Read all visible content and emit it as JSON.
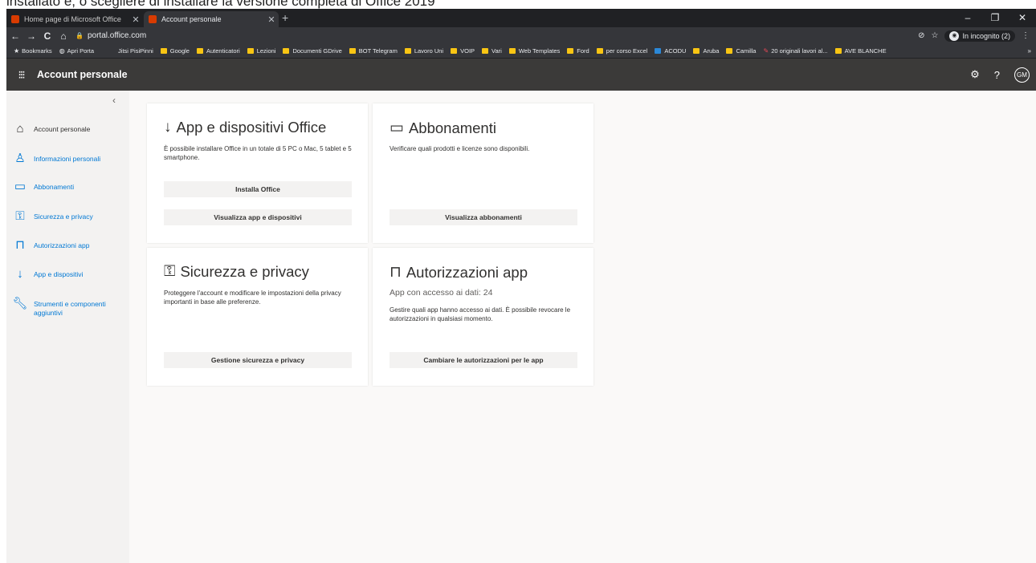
{
  "doc_text": "installato e, o scegliere di installare la versione completa di Office 2019",
  "browser": {
    "tabs": [
      {
        "label": "Home page di Microsoft Office",
        "active": false
      },
      {
        "label": "Account personale",
        "active": true
      }
    ],
    "new_tab": "+",
    "window_controls": [
      "–",
      "❐",
      "✕"
    ],
    "nav": {
      "back": "←",
      "forward": "→",
      "reload": "C",
      "home": "⌂"
    },
    "url": "portal.office.com",
    "incognito_label": "In incognito (2)",
    "bookmarks": [
      {
        "label": "Bookmarks",
        "icon": "star"
      },
      {
        "label": "Apri Porta",
        "icon": "globe"
      },
      {
        "label": "Jitsi PisiPinni",
        "icon": "none"
      },
      {
        "label": "Google",
        "icon": "folder"
      },
      {
        "label": "Autenticatori",
        "icon": "folder"
      },
      {
        "label": "Lezioni",
        "icon": "folder"
      },
      {
        "label": "Documenti GDrive",
        "icon": "folder"
      },
      {
        "label": "BOT Telegram",
        "icon": "folder"
      },
      {
        "label": "Lavoro Uni",
        "icon": "folder"
      },
      {
        "label": "VOIP",
        "icon": "folder"
      },
      {
        "label": "Vari",
        "icon": "folder"
      },
      {
        "label": "Web Templates",
        "icon": "folder"
      },
      {
        "label": "Ford",
        "icon": "folder"
      },
      {
        "label": "per corso Excel",
        "icon": "folder"
      },
      {
        "label": "ACODU",
        "icon": "site"
      },
      {
        "label": "Aruba",
        "icon": "folder"
      },
      {
        "label": "Camilla",
        "icon": "folder"
      },
      {
        "label": "20 originali lavori al...",
        "icon": "pen"
      },
      {
        "label": "AVE BLANCHE",
        "icon": "folder"
      }
    ],
    "bookmarks_more": "»"
  },
  "header": {
    "title": "Account personale",
    "avatar_initials": "GM",
    "help": "?"
  },
  "sidebar": {
    "collapse": "‹",
    "items": [
      {
        "label": "Account personale",
        "icon": "home-icon"
      },
      {
        "label": "Informazioni personali",
        "icon": "person-icon"
      },
      {
        "label": "Abbonamenti",
        "icon": "card-icon"
      },
      {
        "label": "Sicurezza e privacy",
        "icon": "key-icon"
      },
      {
        "label": "Autorizzazioni app",
        "icon": "lock-icon"
      },
      {
        "label": "App e dispositivi",
        "icon": "download-icon"
      },
      {
        "label": "Strumenti e componenti aggiuntivi",
        "icon": "wrench-icon"
      }
    ]
  },
  "cards": {
    "apps": {
      "title": "App e dispositivi Office",
      "desc": "È possibile installare Office in un totale di 5 PC o Mac, 5 tablet e 5 smartphone.",
      "install_label": "Installa Office",
      "view_label": "Visualizza app e dispositivi"
    },
    "subs": {
      "title": "Abbonamenti",
      "desc": "Verificare quali prodotti e licenze sono disponibili.",
      "view_label": "Visualizza abbonamenti"
    },
    "security": {
      "title": "Sicurezza e privacy",
      "desc": "Proteggere l'account e modificare le impostazioni della privacy importanti in base alle preferenze.",
      "manage_label": "Gestione sicurezza e privacy"
    },
    "perms": {
      "title": "Autorizzazioni app",
      "subtitle": "App con accesso ai dati: 24",
      "desc": "Gestire quali app hanno accesso ai dati. È possibile revocare le autorizzazioni in qualsiasi momento.",
      "change_label": "Cambiare le autorizzazioni per le app"
    }
  },
  "colors": {
    "accent": "#0078d4",
    "header_bg": "#3b3a39",
    "nav_bg": "#f3f2f1"
  }
}
